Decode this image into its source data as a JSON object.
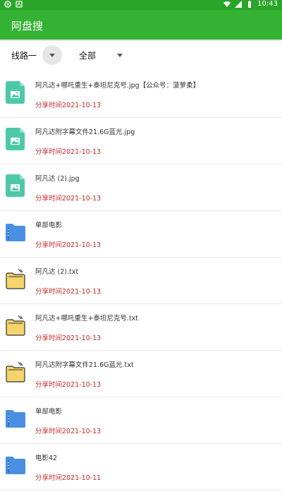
{
  "status": {
    "time": "10:43"
  },
  "app": {
    "title": "阿盘搜"
  },
  "filters": {
    "route": "线路一",
    "category": "全部"
  },
  "files": [
    {
      "icon": "image-file-icon",
      "name": "阿凡达+哪吒重生+泰坦尼克号.jpg【公众号：菠萝柔】",
      "date": "分享时间2021-10-13"
    },
    {
      "icon": "image-file-icon",
      "name": "阿凡达附字幕文件21.6G蓝光.jpg",
      "date": "分享时间2021-10-13"
    },
    {
      "icon": "image-file-icon",
      "name": "阿凡达 (2).jpg",
      "date": "分享时间2021-10-13"
    },
    {
      "icon": "folder-icon",
      "name": "单部电影",
      "date": "分享时间2021-10-13"
    },
    {
      "icon": "text-file-icon",
      "name": "阿凡达 (2).txt",
      "date": "分享时间2021-10-13"
    },
    {
      "icon": "text-file-icon",
      "name": "阿凡达+哪吒重生+泰坦尼克号.txt",
      "date": "分享时间2021-10-13"
    },
    {
      "icon": "text-file-icon",
      "name": "阿凡达附字幕文件21.6G蓝光.txt",
      "date": "分享时间2021-10-13"
    },
    {
      "icon": "folder-icon",
      "name": "单部电影",
      "date": "分享时间2021-10-13"
    },
    {
      "icon": "folder-icon",
      "name": "电影42",
      "date": "分享时间2021-10-11"
    }
  ]
}
